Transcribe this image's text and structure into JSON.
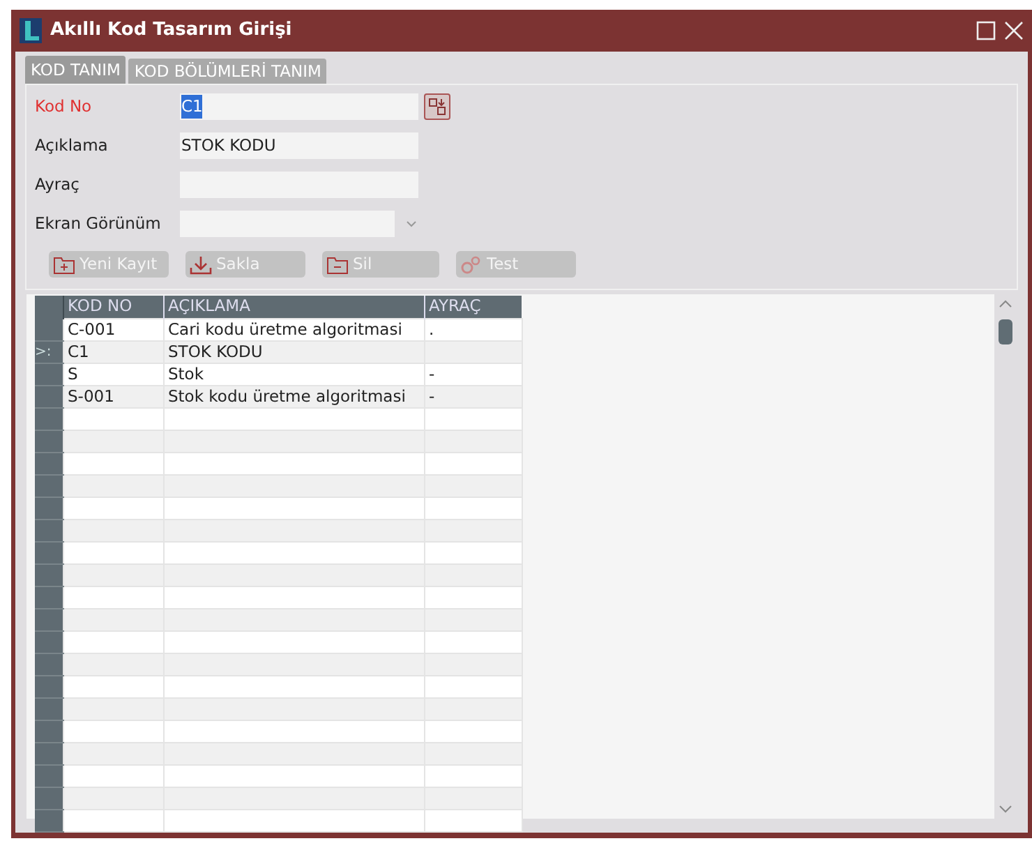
{
  "window": {
    "title": "Akıllı Kod Tasarım Girişi"
  },
  "tabs": [
    {
      "label": "KOD TANIM",
      "selected": true
    },
    {
      "label": "KOD BÖLÜMLERİ TANIM",
      "selected": false
    }
  ],
  "fields": [
    {
      "label": "Kod No",
      "value": "C1",
      "kind": "text",
      "required": true,
      "value_highlighted": true,
      "has_picker": true
    },
    {
      "label": "Açıklama",
      "value": "STOK KODU",
      "kind": "text",
      "required": false,
      "value_highlighted": false,
      "has_picker": false
    },
    {
      "label": "Ayraç",
      "kind": "text",
      "required": false,
      "has_picker": false
    },
    {
      "label": "Ekran Görünüm",
      "kind": "dropdown",
      "required": false,
      "has_picker": false
    }
  ],
  "toolbar": [
    {
      "label": "Yeni Kayıt",
      "kind": "new",
      "disabled": true
    },
    {
      "label": "Sakla",
      "kind": "save",
      "disabled": true
    },
    {
      "label": "Sil",
      "kind": "delete",
      "disabled": true
    },
    {
      "label": "Test",
      "kind": "test",
      "disabled": true
    }
  ],
  "grid": {
    "columns": [
      "KOD NO",
      "AÇIKLAMA",
      "AYRAÇ"
    ],
    "current_row_marker": ">:",
    "rows": [
      {
        "cells": [
          "C-001",
          "Cari kodu üretme algoritmasi",
          "."
        ],
        "selected": false
      },
      {
        "cells": [
          "C1",
          "STOK KODU",
          ""
        ],
        "selected": true
      },
      {
        "cells": [
          "S",
          "Stok",
          "-"
        ],
        "selected": false
      },
      {
        "cells": [
          "S-001",
          "Stok kodu üretme algoritmasi",
          "-"
        ],
        "selected": false
      }
    ]
  }
}
